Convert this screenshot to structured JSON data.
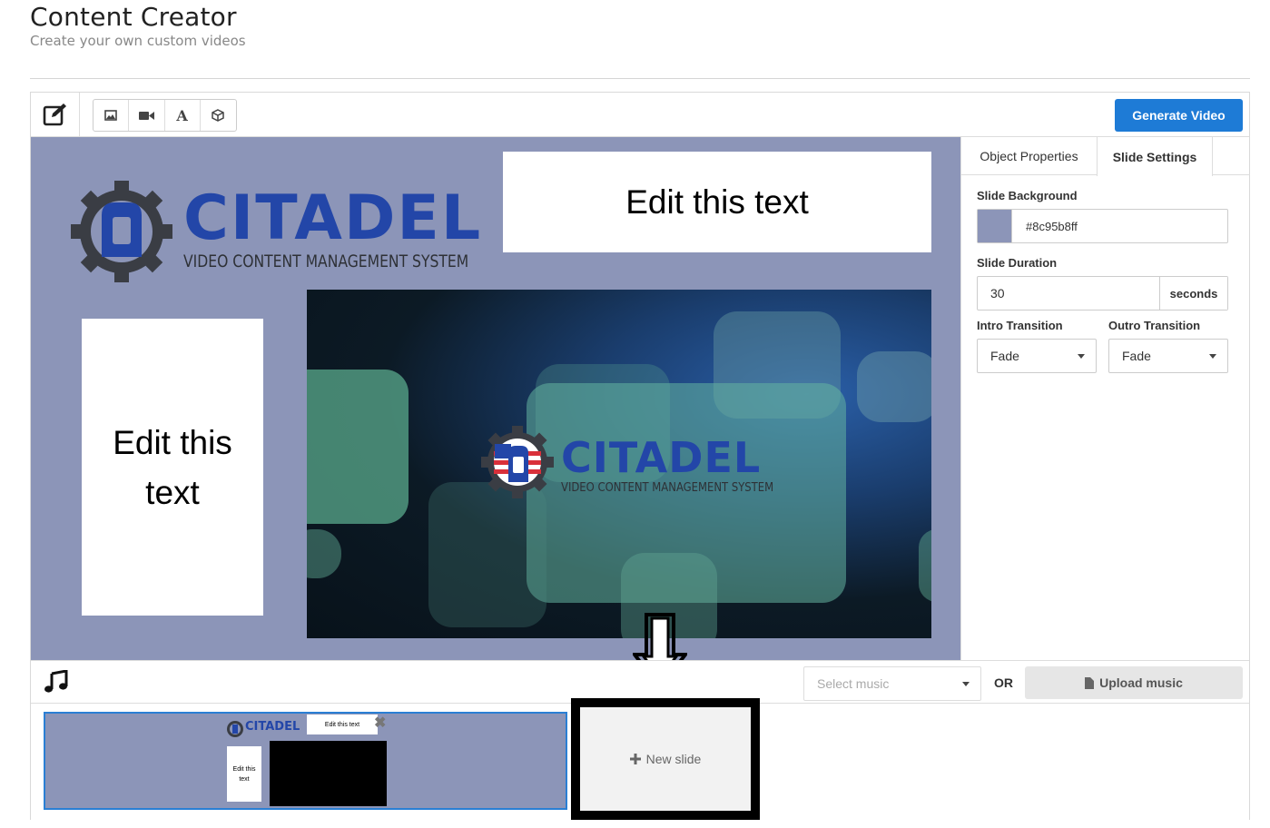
{
  "header": {
    "title": "Content Creator",
    "subtitle": "Create your own custom videos"
  },
  "toolbar": {
    "tools": [
      {
        "icon": "image-icon"
      },
      {
        "icon": "video-camera-icon"
      },
      {
        "icon": "text-font-icon",
        "glyph": "A"
      },
      {
        "icon": "cube-icon"
      }
    ],
    "generate_label": "Generate Video"
  },
  "canvas": {
    "background": "#8c95b8",
    "logo": {
      "name": "CITADEL",
      "tagline": "VIDEO CONTENT MANAGEMENT SYSTEM"
    },
    "top_text": "Edit this text",
    "left_text_line1": "Edit this",
    "left_text_line2": "text",
    "video_logo": {
      "name": "CITADEL",
      "tagline": "VIDEO CONTENT MANAGEMENT SYSTEM"
    }
  },
  "properties": {
    "tabs": [
      "Object Properties",
      "Slide Settings"
    ],
    "active_tab": "Slide Settings",
    "slide_background_label": "Slide Background",
    "slide_background_value": "#8c95b8ff",
    "slide_duration_label": "Slide Duration",
    "slide_duration_value": "30",
    "slide_duration_unit": "seconds",
    "intro_label": "Intro Transition",
    "intro_value": "Fade",
    "outro_label": "Outro Transition",
    "outro_value": "Fade"
  },
  "music": {
    "select_placeholder": "Select music",
    "or_label": "OR",
    "upload_label": "Upload music"
  },
  "slides": {
    "thumb": {
      "logo": "CITADEL",
      "top_text": "Edit this text",
      "left_text_line1": "Edit this",
      "left_text_line2": "text"
    },
    "new_slide_label": "New slide"
  }
}
